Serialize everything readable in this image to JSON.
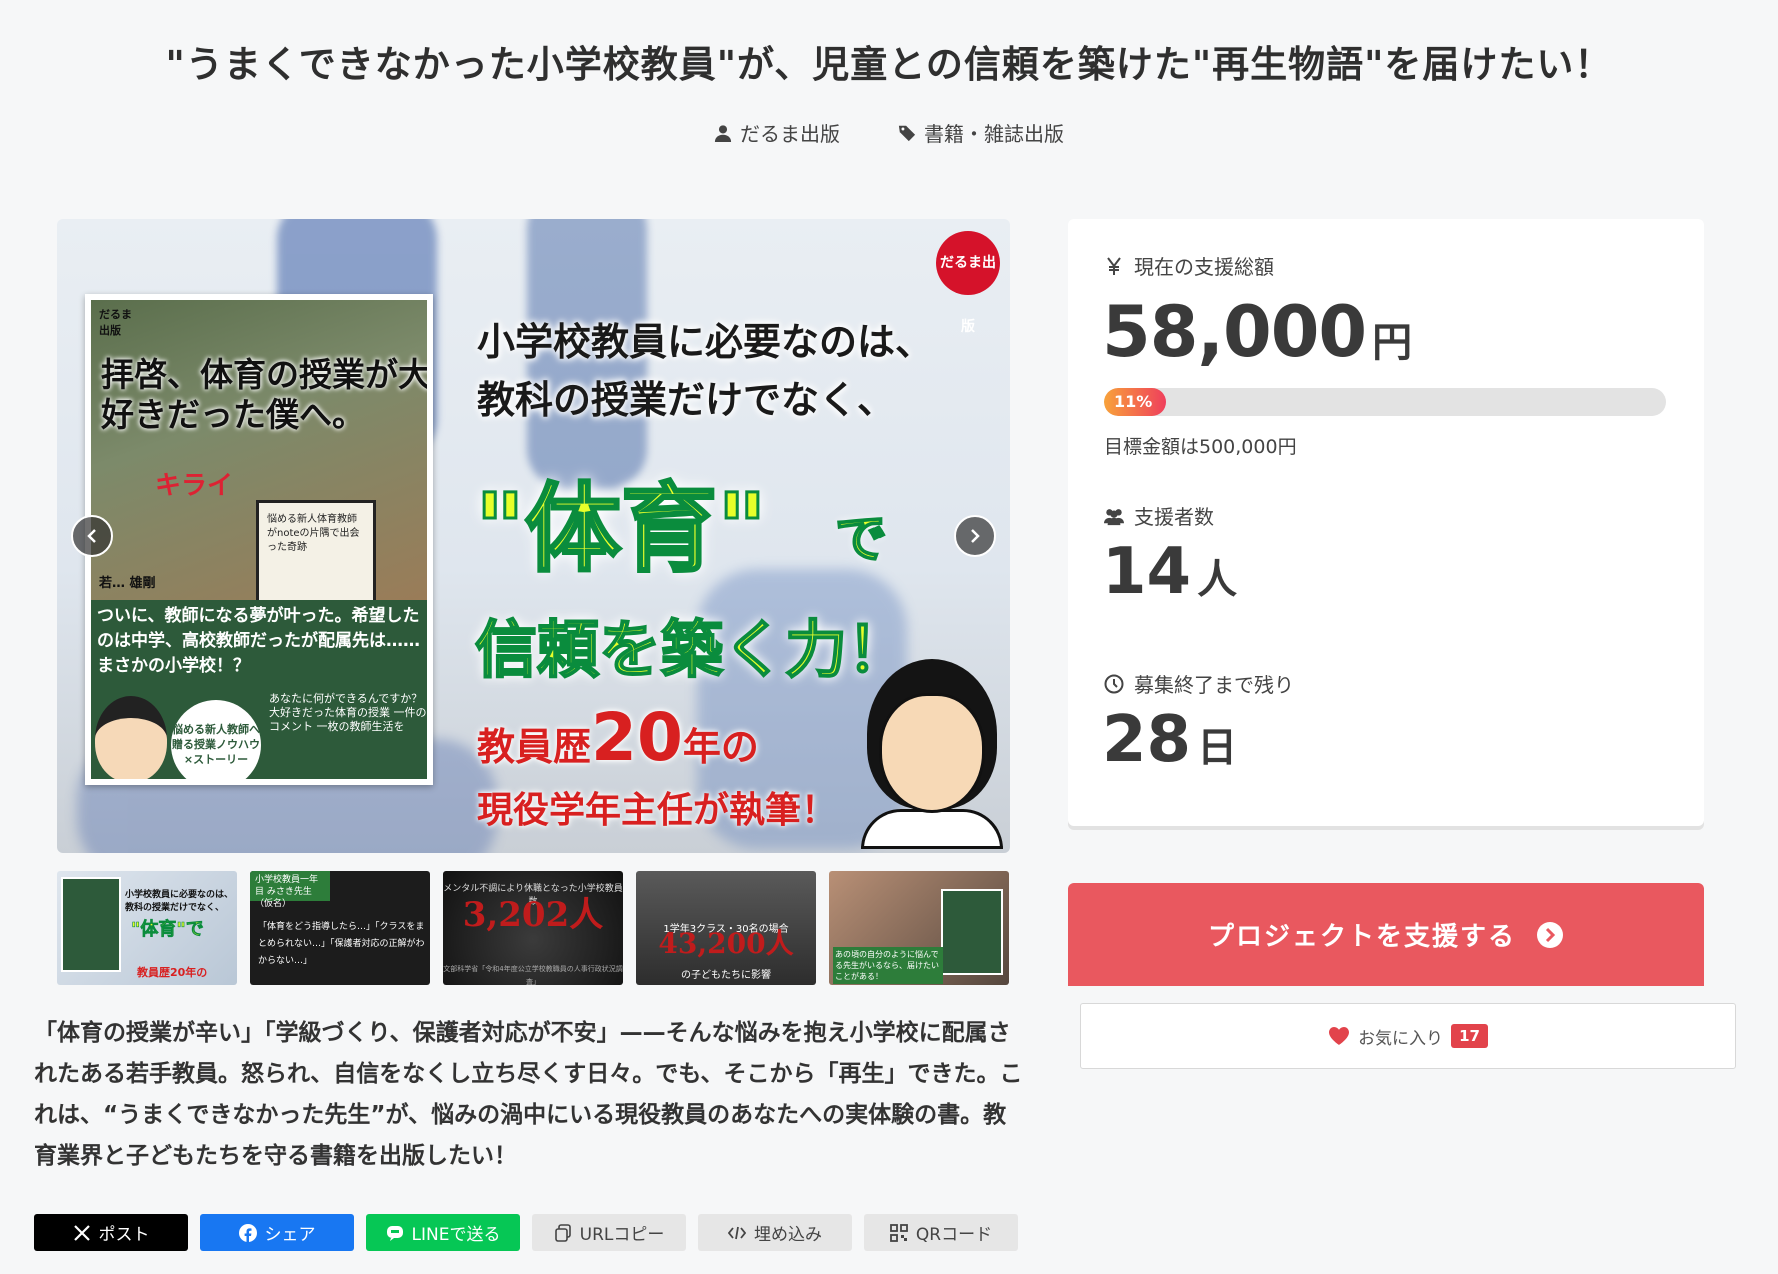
{
  "project": {
    "title": "\"うまくできなかった小学校教員\"が、児童との信頼を築けた\"再生物語\"を届けたい！",
    "owner": "だるま出版",
    "category": "書籍・雑誌出版"
  },
  "hero": {
    "logo": "だるま出版",
    "line1": "小学校教員に必要なのは、",
    "line2": "教科の授業だけでなく、",
    "big": "\"体育\"",
    "de": "で",
    "trust": "信頼を築く力！",
    "career_pre": "教員歴",
    "career_num": "20",
    "career_post": "年の",
    "author": "現役学年主任が執筆！",
    "book": {
      "logo": "だるま出版",
      "title": "拝啓、体育の授業が大好きだった僕へ。",
      "strike": "キライ",
      "sign": "悩める新人体育教師がnoteの片隅で出会った奇跡",
      "author": "若… 雄剛",
      "green_text": "ついに、教師になる夢が叶った。希望したのは中学、高校教師だったが配属先は……まさかの小学校！？",
      "circle": "悩める新人教師へ贈る授業ノウハウ×ストーリー",
      "vertical": "あなたに何ができるんですか？ 大好きだった体育の授業 一件のコメント 一枚の教師生活を"
    }
  },
  "thumbnails": [
    {
      "a": "小学校教員に必要なのは、教科の授業だけでなく、",
      "b": "\"体育\"で",
      "c": "教員歴20年の"
    },
    {
      "a": "小学校教員一年目 みさき先生（仮名）",
      "b": "「体育をどう指導したら…」「クラスをまとめられない…」「保護者対応の正解がわからない…」"
    },
    {
      "a": "メンタル不調により休職となった小学校教員数",
      "b": "3,202人",
      "c": "文部科学省「令和4年度公立学校教職員の人事行政状況調査」"
    },
    {
      "a": "1学年3クラス・30名の場合",
      "b": "43,200人",
      "c": "の子どもたちに影響"
    },
    {
      "a": "あの頃の自分のように悩んでる先生がいるなら、届けたいことがある！"
    }
  ],
  "description": "「体育の授業が辛い」「学級づくり、保護者対応が不安」——そんな悩みを抱え小学校に配属されたある若手教員。怒られ、自信をなくし立ち尽くす日々。でも、そこから「再生」できた。これは、“うまくできなかった先生”が、悩みの渦中にいる現役教員のあなたへの実体験の書。教育業界と子どもたちを守る書籍を出版したい！",
  "share": {
    "x": "ポスト",
    "facebook": "シェア",
    "line": "LINEで送る",
    "url": "URLコピー",
    "embed": "埋め込み",
    "qr": "QRコード"
  },
  "stats": {
    "amount_label": "現在の支援総額",
    "amount": "58,000",
    "amount_unit": "円",
    "progress_percent": 11,
    "progress_label": "11%",
    "goal": "目標金額は500,000円",
    "supporters_label": "支援者数",
    "supporters": "14",
    "supporters_unit": "人",
    "remaining_label": "募集終了まで残り",
    "remaining": "28",
    "remaining_unit": "日"
  },
  "actions": {
    "support": "プロジェクトを支援する",
    "favorite": "お気に入り",
    "favorite_count": "17"
  },
  "colors": {
    "cta": "#e9585f",
    "badge": "#e2434b",
    "progress_start": "#f8a23a",
    "progress_end": "#ef3f5c",
    "line": "#06c755",
    "facebook": "#1877f2"
  }
}
